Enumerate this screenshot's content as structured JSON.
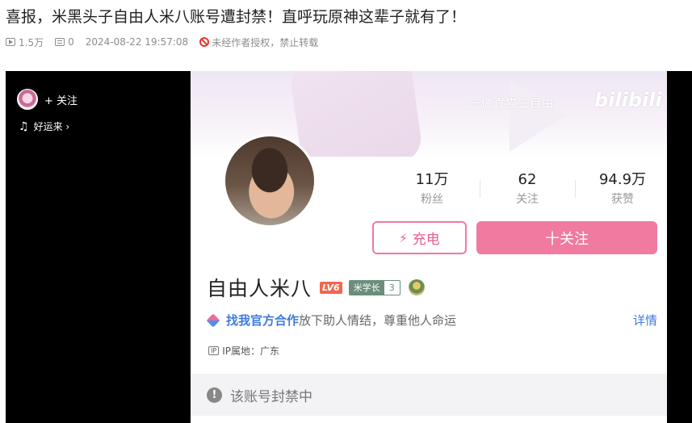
{
  "article": {
    "title": "喜报，米黑头子自由人米八账号遭封禁！直呼玩原神这辈子就有了！",
    "views": "1.5万",
    "comments": "0",
    "datetime": "2024-08-22 19:57:08",
    "copyright": "未经作者授权，禁止转载"
  },
  "video_overlay": {
    "follow_label": "+ 关注",
    "music_label": "好运来 ›",
    "music_icon": "♫"
  },
  "profile": {
    "banner_watermark": "一僵直猫三目由",
    "banner_logo": "bilibili",
    "stats": [
      {
        "value": "11万",
        "label": "粉丝"
      },
      {
        "value": "62",
        "label": "关注"
      },
      {
        "value": "94.9万",
        "label": "获赞"
      }
    ],
    "charge_label": "充电",
    "charge_icon": "⚡",
    "follow_label": "十关注",
    "name": "自由人米八",
    "level": "LV6",
    "medal_name": "米学长",
    "medal_level": "3",
    "coop_link": "找我官方合作",
    "signature": "放下助人情结，尊重他人命运",
    "more_label": "详情",
    "ip_badge": "IP",
    "ip_location": "IP属地：广东",
    "banned_text": "该账号封禁中",
    "banned_icon": "!"
  },
  "colors": {
    "accent_pink": "#f07aa0",
    "link_blue": "#3d7be0",
    "ban_red": "#e0362d"
  }
}
